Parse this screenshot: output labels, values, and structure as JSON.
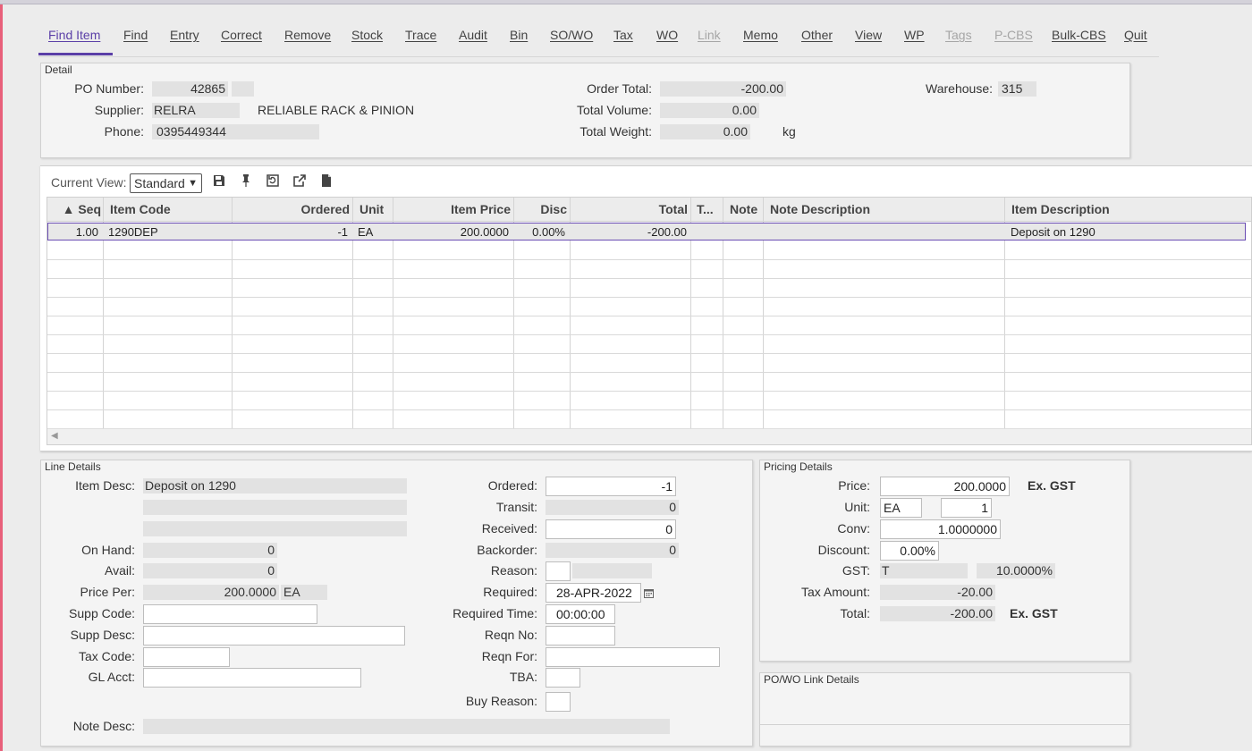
{
  "menu": {
    "items": [
      "Find Item",
      "Find",
      "Entry",
      "Correct",
      "Remove",
      "Stock",
      "Trace",
      "Audit",
      "Bin",
      "SO/WO",
      "Tax",
      "WO",
      "Link",
      "Memo",
      "Other",
      "View",
      "WP",
      "Tags",
      "P-CBS",
      "Bulk-CBS",
      "Quit"
    ]
  },
  "detail": {
    "title": "Detail",
    "po_number_label": "PO Number:",
    "po_number": "42865",
    "supplier_label": "Supplier:",
    "supplier_code": "RELRA",
    "supplier_name": "RELIABLE RACK & PINION",
    "phone_label": "Phone:",
    "phone": "0395449344",
    "order_total_label": "Order Total:",
    "order_total": "-200.00",
    "total_volume_label": "Total Volume:",
    "total_volume": "0.00",
    "total_weight_label": "Total Weight:",
    "total_weight": "0.00",
    "weight_unit": "kg",
    "warehouse_label": "Warehouse:",
    "warehouse": "315"
  },
  "grid": {
    "current_view_label": "Current View:",
    "current_view": "Standard",
    "toolbar_icons": [
      "save-icon",
      "pin-icon",
      "reset-icon",
      "export-icon",
      "document-icon"
    ],
    "columns": [
      "▲ Seq",
      "Item Code",
      "Ordered",
      "Unit",
      "Item Price",
      "Disc",
      "Total",
      "T...",
      "Note",
      "Note Description",
      "Item Description"
    ],
    "rows": [
      [
        "1.00",
        "1290DEP",
        "-1",
        "EA",
        "200.0000",
        "0.00%",
        "-200.00",
        "",
        "",
        "",
        "Deposit on 1290"
      ]
    ]
  },
  "line_details": {
    "title": "Line Details",
    "item_desc_label": "Item Desc:",
    "item_desc": "Deposit on 1290",
    "on_hand_label": "On Hand:",
    "on_hand": "0",
    "avail_label": "Avail:",
    "avail": "0",
    "price_per_label": "Price Per:",
    "price_per": "200.0000",
    "price_per_unit": "EA",
    "supp_code_label": "Supp Code:",
    "supp_desc_label": "Supp Desc:",
    "tax_code_label": "Tax Code:",
    "gl_acct_label": "GL Acct:",
    "note_desc_label": "Note Desc:",
    "ordered_label": "Ordered:",
    "ordered": "-1",
    "transit_label": "Transit:",
    "transit": "0",
    "received_label": "Received:",
    "received": "0",
    "backorder_label": "Backorder:",
    "backorder": "0",
    "reason_label": "Reason:",
    "required_label": "Required:",
    "required": "28-APR-2022",
    "required_time_label": "Required Time:",
    "required_time": "00:00:00",
    "reqn_no_label": "Reqn No:",
    "reqn_for_label": "Reqn For:",
    "tba_label": "TBA:",
    "buy_reason_label": "Buy Reason:"
  },
  "pricing": {
    "title": "Pricing Details",
    "price_label": "Price:",
    "price": "200.0000",
    "ex_gst": "Ex. GST",
    "unit_label": "Unit:",
    "unit": "EA",
    "unit_qty": "1",
    "conv_label": "Conv:",
    "conv": "1.0000000",
    "discount_label": "Discount:",
    "discount": "0.00%",
    "gst_label": "GST:",
    "gst_code": "T",
    "gst_rate": "10.0000%",
    "tax_amount_label": "Tax Amount:",
    "tax_amount": "-20.00",
    "total_label": "Total:",
    "total": "-200.00",
    "total_ex_gst": "Ex. GST"
  },
  "link_details": {
    "title": "PO/WO Link Details"
  }
}
